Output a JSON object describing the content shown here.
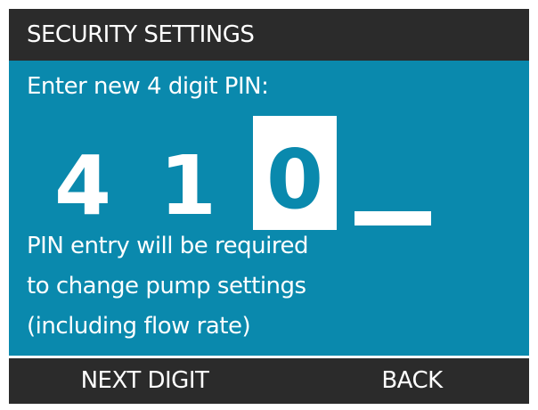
{
  "header": {
    "title": "SECURITY SETTINGS"
  },
  "pin_entry": {
    "prompt": "Enter new 4 digit PIN:",
    "digits": [
      "4",
      "1",
      "0",
      ""
    ],
    "active_digit_index": 2
  },
  "info": {
    "lines": [
      "PIN entry will be required",
      "to change pump settings",
      "(including flow rate)"
    ]
  },
  "softkeys": {
    "left_label": "NEXT DIGIT",
    "right_label": "BACK"
  },
  "colors": {
    "panel": "#0a89ad",
    "header": "#2b2b2b",
    "text": "#ffffff"
  }
}
